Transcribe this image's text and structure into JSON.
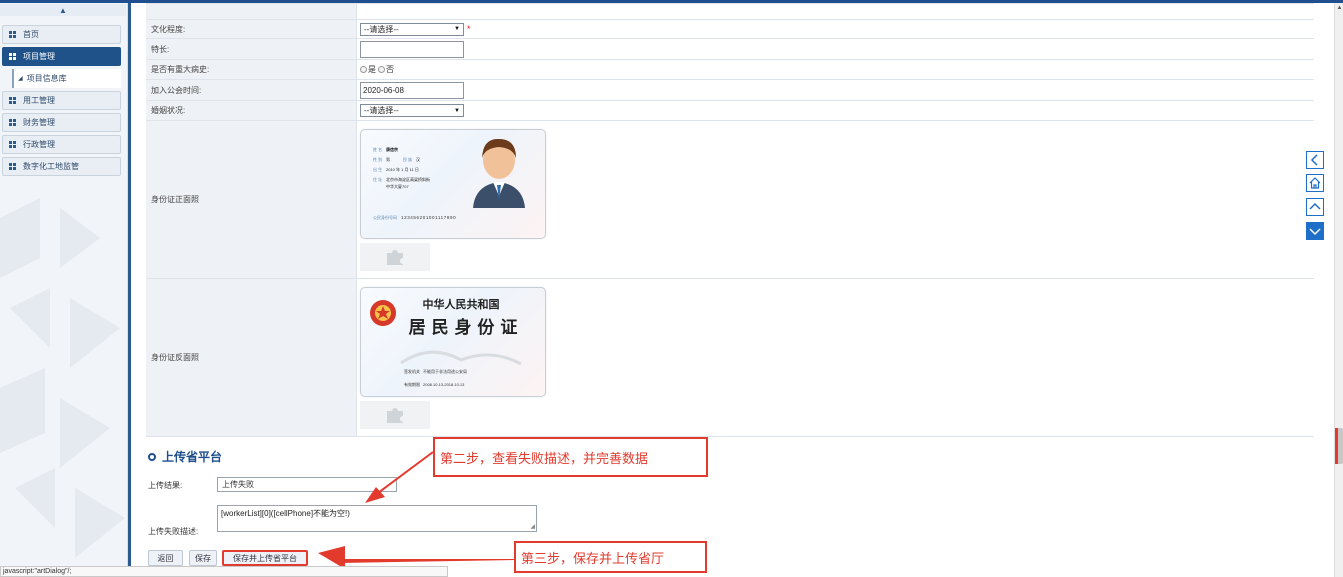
{
  "sidebar": {
    "collapse_glyph": "▲",
    "menu": [
      {
        "label": "首页",
        "active": false
      },
      {
        "label": "项目管理",
        "active": true
      },
      {
        "label": "项目信息库",
        "sub": true
      },
      {
        "label": "用工管理",
        "active": false
      },
      {
        "label": "财务管理",
        "active": false
      },
      {
        "label": "行政管理",
        "active": false
      },
      {
        "label": "数字化工地监管",
        "active": false
      }
    ]
  },
  "form": {
    "education": {
      "label": "文化程度:",
      "value": "--请选择--",
      "required_mark": "*"
    },
    "specialty": {
      "label": "特长:",
      "value": ""
    },
    "major_illness": {
      "label": "是否有重大病史:",
      "options": [
        "是",
        "否"
      ]
    },
    "join_date": {
      "label": "加入公会时间:",
      "value": "2020-06-08"
    },
    "marital": {
      "label": "婚姻状况:",
      "value": "--请选择--"
    },
    "id_front": {
      "label": "身份证正面照",
      "card": {
        "name_label": "姓 名",
        "name": "康信宗",
        "gender_label": "性 别",
        "gender": "男",
        "ethnic_label": "民 族",
        "ethnic": "汉",
        "birth_label": "出 生",
        "birth": "2010 年 1 月 11 日",
        "address_label": "住 址",
        "address_line1": "北京市海淀区高梁桥斜街",
        "address_line2": "中华大厦707",
        "id_label": "公民身份号码",
        "id_number": "123456201001117890"
      }
    },
    "id_back": {
      "label": "身份证反面照",
      "card": {
        "country": "中华人民共和国",
        "title": "居 民 身 份 证",
        "authority_label": "签发机关",
        "authority": "不能用于非法用途公安局",
        "validity_label": "有效期限",
        "validity": "2008.10.13-2018.10.13"
      }
    }
  },
  "upload": {
    "section_title": "上传省平台",
    "result_label": "上传结果:",
    "result_value": "上传失败",
    "fail_label": "上传失败描述:",
    "fail_value": "[workerList][0]([cellPhone]不能为空!)"
  },
  "buttons": {
    "back": "返回",
    "save": "保存",
    "save_upload": "保存并上传省平台"
  },
  "annotations": {
    "step2": "第二步，查看失败描述，并完善数据",
    "step3": "第三步，保存并上传省厅",
    "color": "#e23b2e"
  },
  "statusbar": {
    "text": "javascript:\"artDialog\"/;"
  },
  "right_nav": [
    "chevron-left-icon",
    "home-icon",
    "chevron-up-icon",
    "chevron-down-icon"
  ]
}
